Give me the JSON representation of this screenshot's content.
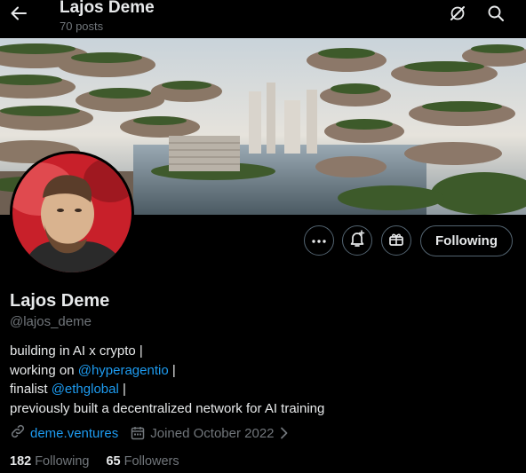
{
  "header": {
    "title": "Lajos Deme",
    "posts_count": "70 posts"
  },
  "profile": {
    "name": "Lajos Deme",
    "handle": "@lajos_deme",
    "bio": {
      "line1": "building in AI x crypto |",
      "line2_prefix": "working on ",
      "line2_link": "@hyperagentio",
      "line2_suffix": " |",
      "line3_prefix": "finalist ",
      "line3_link": "@ethglobal",
      "line3_suffix": " |",
      "line4": "previously built a decentralized network for AI training"
    },
    "website": "deme.ventures",
    "joined": "Joined October 2022",
    "following_count": "182",
    "following_label": "Following",
    "followers_count": "65",
    "followers_label": "Followers"
  },
  "actions": {
    "following_button": "Following"
  },
  "colors": {
    "background": "#000000",
    "text": "#e7e9ea",
    "muted": "#71767b",
    "link": "#1d9bf0",
    "border": "#536471"
  },
  "icons": [
    "back-arrow-icon",
    "grok-icon",
    "search-icon",
    "more-icon",
    "notification-bell-icon",
    "subscribe-gift-icon",
    "link-icon",
    "calendar-icon",
    "chevron-right-icon"
  ]
}
